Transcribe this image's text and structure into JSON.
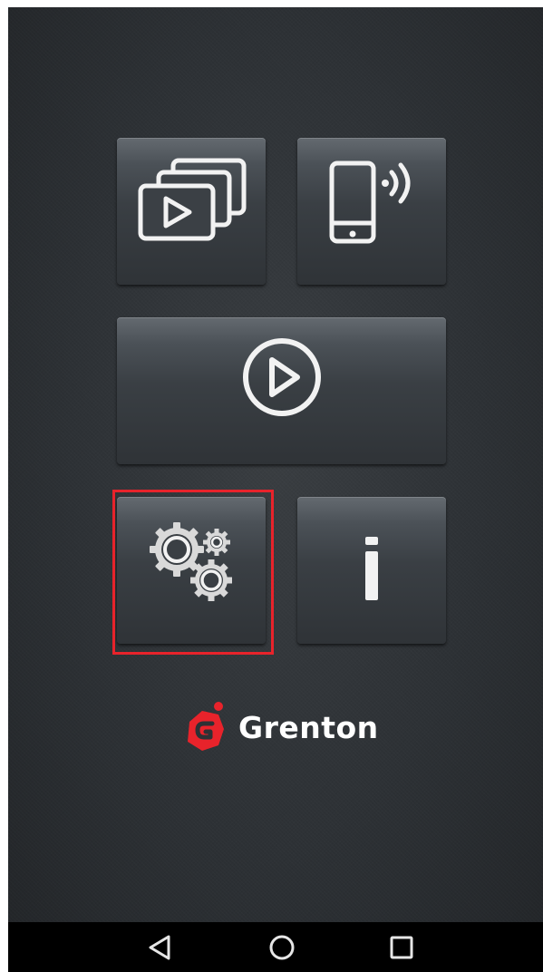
{
  "app": {
    "brand_name": "Grenton",
    "brand_color": "#e8232b",
    "background_color": "#2d3135"
  },
  "tiles": [
    {
      "id": "slideshow",
      "icon": "slideshow-stack-icon"
    },
    {
      "id": "remote",
      "icon": "phone-wireless-icon"
    },
    {
      "id": "play",
      "icon": "play-circle-icon"
    },
    {
      "id": "settings",
      "icon": "gears-icon",
      "selected": true
    },
    {
      "id": "info",
      "icon": "info-icon"
    }
  ],
  "navbar": {
    "buttons": [
      {
        "id": "back",
        "icon": "back-triangle-icon"
      },
      {
        "id": "home",
        "icon": "home-circle-icon"
      },
      {
        "id": "recents",
        "icon": "recents-square-icon"
      }
    ]
  }
}
